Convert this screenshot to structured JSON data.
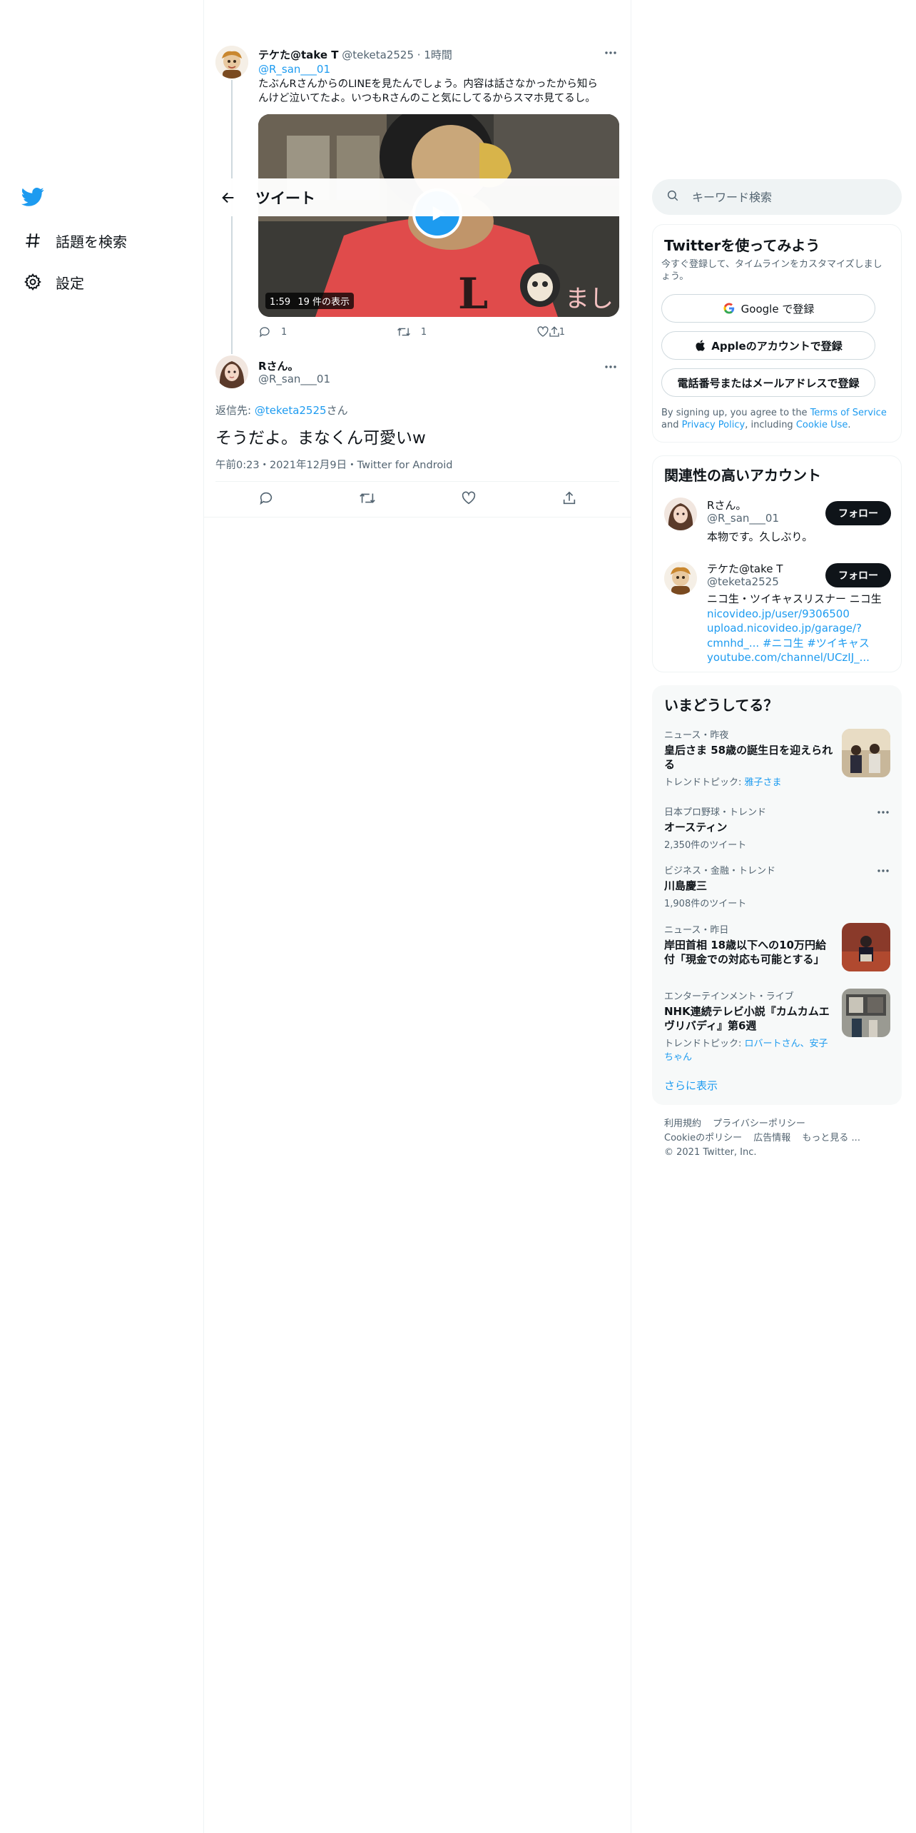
{
  "nav": {
    "logo": "twitter-bird-icon",
    "items": [
      {
        "label": "話題を検索",
        "icon": "hashtag-icon"
      },
      {
        "label": "設定",
        "icon": "gear-icon"
      }
    ]
  },
  "header": {
    "title": "ツイート"
  },
  "parent_tweet": {
    "name": "テケた@take T",
    "handle": "@teketa2525",
    "time": "1時間",
    "reply_to": "@R_san___01",
    "text_line1": "たぶんRさんからのLINEを見たんでしょう。内容は話さなかったから知ら",
    "text_line2": "んけど泣いてたよ。いつもRさんのこと気にしてるからスマホ見てるし。",
    "video": {
      "duration": "1:59",
      "views": "19 件の表示"
    },
    "counts": {
      "replies": "1",
      "retweets": "1",
      "likes": "1"
    }
  },
  "main_tweet": {
    "name": "Rさん。",
    "handle": "@R_san___01",
    "reply_prefix": "返信先: ",
    "reply_handle": "@teketa2525",
    "reply_suffix": "さん",
    "text": "そうだよ。まなくん可愛いw",
    "meta": "午前0:23・2021年12月9日・Twitter for Android"
  },
  "search": {
    "placeholder": "キーワード検索"
  },
  "signup": {
    "title": "Twitterを使ってみよう",
    "subtitle": "今すぐ登録して、タイムラインをカスタマイズしましょう。",
    "google": "Google で登録",
    "apple": "Appleのアカウントで登録",
    "phone": "電話番号またはメールアドレスで登録",
    "terms_pre": "By signing up, you agree to the ",
    "terms_link": "Terms of Service",
    "terms_and": " and",
    "privacy_link": "Privacy Policy",
    "including": ", including ",
    "cookie_link": "Cookie Use",
    "period": "."
  },
  "related": {
    "title": "関連性の高いアカウント",
    "follow": "フォロー",
    "accounts": [
      {
        "name": "Rさん。",
        "handle": "@R_san___01",
        "bio": "本物です。久しぶり。"
      },
      {
        "name": "テケた@take T",
        "handle": "@teketa2525",
        "bio_text": "ニコ生・ツイキャスリスナー ニコ生",
        "link1": "nicovideo.jp/user/9306500",
        "link2": "upload.nicovideo.jp/garage/?",
        "link3": "cmnhd_... #ニコ生 #ツイキャス",
        "link4": "youtube.com/channel/UCzIJ_..."
      }
    ]
  },
  "trends": {
    "title": "いまどうしてる？",
    "items": [
      {
        "meta": "ニュース・昨夜",
        "title": "皇后さま 58歳の誕生日を迎えられる",
        "topic_label": "トレンドトピック: ",
        "topic": "雅子さま"
      },
      {
        "meta": "日本プロ野球・トレンド",
        "title": "オースティン",
        "count": "2,350件のツイート"
      },
      {
        "meta": "ビジネス・金融・トレンド",
        "title": "川島慶三",
        "count": "1,908件のツイート"
      },
      {
        "meta": "ニュース・昨日",
        "title": "岸田首相 18歳以下への10万円給付「現金での対応も可能とする」"
      },
      {
        "meta": "エンターテインメント・ライブ",
        "title": "NHK連続テレビ小説『カムカムエヴリバディ』第6週",
        "topic_label": "トレンドトピック: ",
        "topic": "ロバートさん、安子ちゃん"
      }
    ],
    "show_more": "さらに表示"
  },
  "footer": {
    "terms": "利用規約",
    "privacy": "プライバシーポリシー",
    "cookie": "Cookieのポリシー",
    "ads": "広告情報",
    "more": "もっと見る ...",
    "copyright": "© 2021 Twitter, Inc."
  },
  "colors": {
    "accent": "#1d9bf0",
    "text": "#0f1419",
    "muted": "#536471",
    "border": "#eff3f4"
  }
}
